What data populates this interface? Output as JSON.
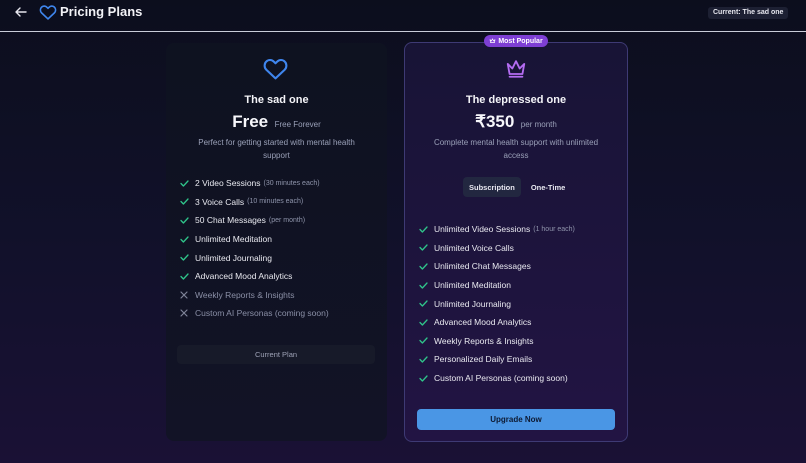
{
  "header": {
    "title": "Pricing Plans",
    "current_badge": "Current: The sad one"
  },
  "plans": [
    {
      "name": "The sad one",
      "price": "Free",
      "price_suffix": "Free Forever",
      "description": "Perfect for getting started with mental health support",
      "icon": "heart-icon",
      "features": [
        {
          "text": "2 Video Sessions",
          "note": "(30 minutes each)",
          "included": true
        },
        {
          "text": "3 Voice Calls",
          "note": "(10 minutes each)",
          "included": true
        },
        {
          "text": "50 Chat Messages",
          "note": "(per month)",
          "included": true
        },
        {
          "text": "Unlimited Meditation",
          "note": "",
          "included": true
        },
        {
          "text": "Unlimited Journaling",
          "note": "",
          "included": true
        },
        {
          "text": "Advanced Mood Analytics",
          "note": "",
          "included": true
        },
        {
          "text": "Weekly Reports & Insights",
          "note": "",
          "included": false
        },
        {
          "text": "Custom AI Personas (coming soon)",
          "note": "",
          "included": false
        }
      ],
      "button_label": "Current Plan"
    },
    {
      "badge": "Most Popular",
      "name": "The depressed one",
      "price": "₹350",
      "price_suffix": "per month",
      "description": "Complete mental health support with unlimited access",
      "icon": "crown-icon",
      "toggle": [
        "Subscription",
        "One-Time"
      ],
      "toggle_selected": "Subscription",
      "features": [
        {
          "text": "Unlimited Video Sessions",
          "note": "(1 hour each)",
          "included": true
        },
        {
          "text": "Unlimited Voice Calls",
          "note": "",
          "included": true
        },
        {
          "text": "Unlimited Chat Messages",
          "note": "",
          "included": true
        },
        {
          "text": "Unlimited Meditation",
          "note": "",
          "included": true
        },
        {
          "text": "Unlimited Journaling",
          "note": "",
          "included": true
        },
        {
          "text": "Advanced Mood Analytics",
          "note": "",
          "included": true
        },
        {
          "text": "Weekly Reports & Insights",
          "note": "",
          "included": true
        },
        {
          "text": "Personalized Daily Emails",
          "note": "",
          "included": true
        },
        {
          "text": "Custom AI Personas (coming soon)",
          "note": "",
          "included": true
        }
      ],
      "button_label": "Upgrade Now"
    }
  ],
  "colors": {
    "check": "#2fc48a",
    "accent_blue": "#4a96e5",
    "accent_purple": "#7e3fd4",
    "heart_icon": "#3f86ee",
    "crown_icon": "#b46cf2"
  }
}
